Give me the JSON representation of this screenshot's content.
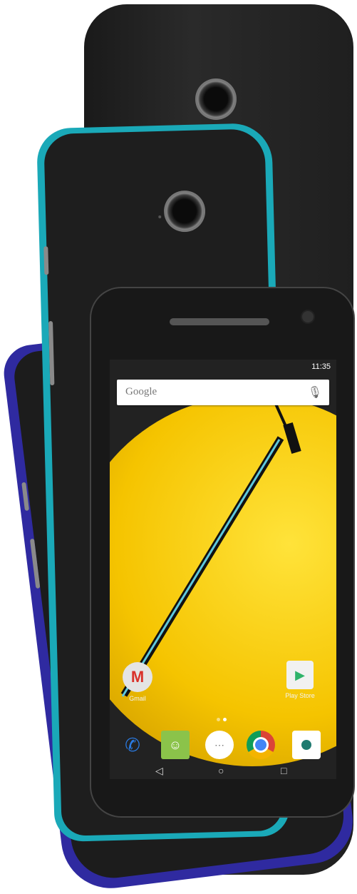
{
  "screen": {
    "status_time": "11:35",
    "search_placeholder": "Google"
  },
  "apps": {
    "gmail_label": "Gmail",
    "play_label": "Play Store"
  },
  "nav": {
    "back": "◁",
    "home": "○",
    "recents": "□"
  },
  "colors": {
    "teal": "#1aa9b8",
    "blue": "#2f2aa0",
    "black": "#181818",
    "wallpaper_yellow": "#ffe33a"
  }
}
